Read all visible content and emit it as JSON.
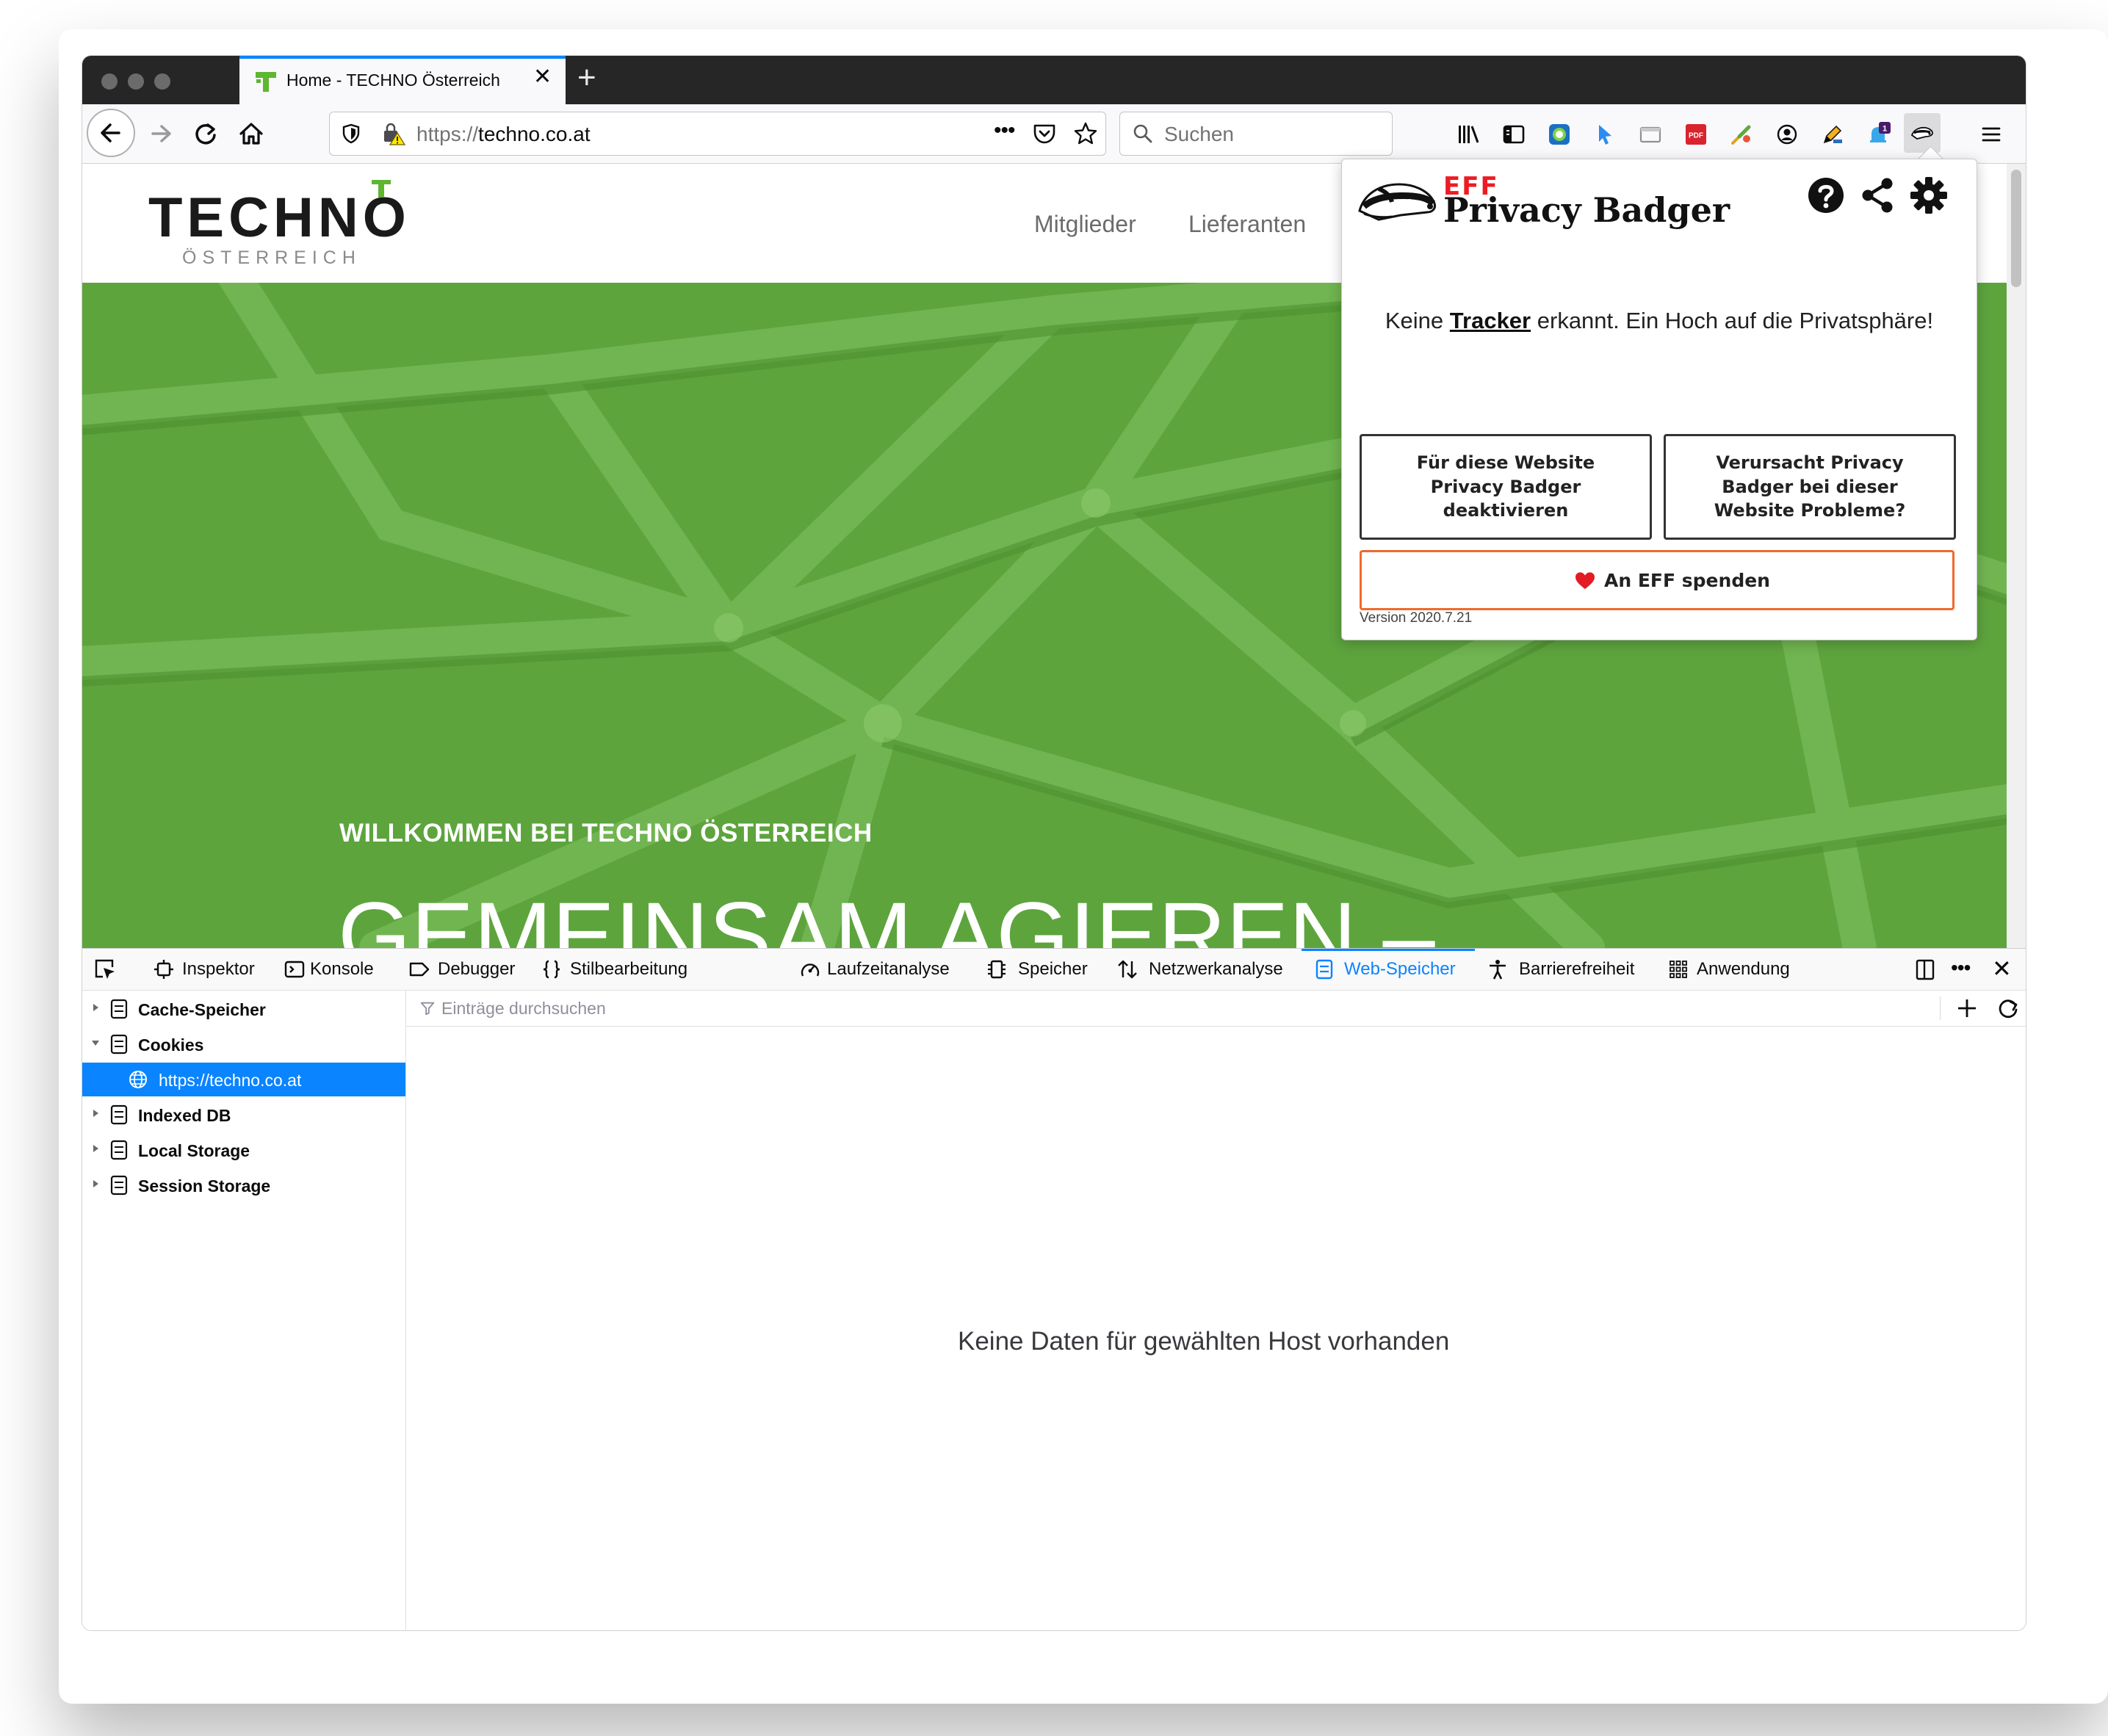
{
  "browser": {
    "tab": {
      "title": "Home - TECHNO Österreich"
    },
    "url": {
      "scheme": "https://",
      "host": "techno.co.at"
    },
    "search_placeholder": "Suchen"
  },
  "site": {
    "logo": {
      "main": "TECHNO",
      "sub": "ÖSTERREICH"
    },
    "nav": [
      "Mitglieder",
      "Lieferanten"
    ],
    "hero": {
      "subtitle": "WILLKOMMEN BEI TECHNO ÖSTERREICH",
      "title": "GEMEINSAM AGIEREN –"
    }
  },
  "privacy_badger": {
    "brand_top": "EFF",
    "brand_name": "Privacy Badger",
    "message_before": "Keine",
    "message_link": "Tracker",
    "message_after": "erkannt. Ein Hoch auf die Privatsphäre!",
    "disable_button": "Für diese Website Privacy Badger deaktivieren",
    "problems_button": "Verursacht Privacy Badger bei dieser Website Probleme?",
    "donate_button": "An EFF spenden",
    "version": "Version 2020.7.21"
  },
  "devtools": {
    "tabs": [
      {
        "label": "Inspektor",
        "icon": "inspector-icon"
      },
      {
        "label": "Konsole",
        "icon": "console-icon"
      },
      {
        "label": "Debugger",
        "icon": "debugger-icon"
      },
      {
        "label": "Stilbearbeitung",
        "icon": "braces-icon"
      },
      {
        "label": "Laufzeitanalyse",
        "icon": "gauge-icon"
      },
      {
        "label": "Speicher",
        "icon": "chip-icon"
      },
      {
        "label": "Netzwerkanalyse",
        "icon": "updown-arrows-icon"
      },
      {
        "label": "Web-Speicher",
        "icon": "storage-icon"
      },
      {
        "label": "Barrierefreiheit",
        "icon": "accessibility-icon"
      },
      {
        "label": "Anwendung",
        "icon": "grid-icon"
      }
    ],
    "active_tab": "Web-Speicher",
    "storage_tree": [
      {
        "label": "Cache-Speicher",
        "expanded": false
      },
      {
        "label": "Cookies",
        "expanded": true
      },
      {
        "label": "https://techno.co.at",
        "child": true,
        "selected": true
      },
      {
        "label": "Indexed DB",
        "expanded": false
      },
      {
        "label": "Local Storage",
        "expanded": false
      },
      {
        "label": "Session Storage",
        "expanded": false
      }
    ],
    "filter_placeholder": "Einträge durchsuchen",
    "empty_message": "Keine Daten für gewählten Host vorhanden"
  },
  "colors": {
    "accent": "#0a84ff",
    "hero_green": "#5da43d",
    "logo_green": "#5fb631",
    "eff_red": "#ec1c24",
    "donate_orange": "#f06a2b"
  }
}
